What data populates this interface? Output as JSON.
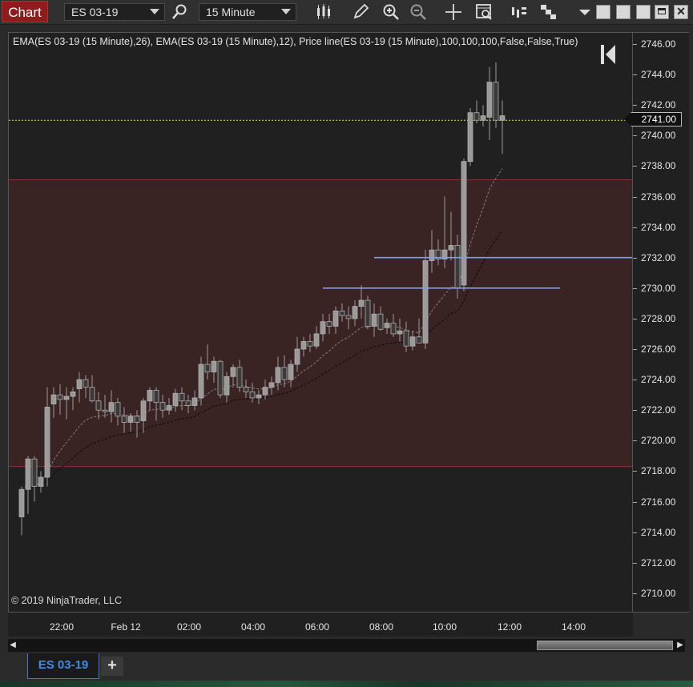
{
  "toolbar": {
    "chart_label": "Chart",
    "instrument": "ES 03-19",
    "interval": "15 Minute",
    "icons": [
      "search-icon",
      "bar-type-icon",
      "draw-pencil-icon",
      "zoom-in-icon",
      "zoom-out-icon",
      "crosshair-icon",
      "data-box-icon",
      "indicators-icon",
      "strategies-icon",
      "menu-dropdown-icon"
    ]
  },
  "chart": {
    "indicator_label": "EMA(ES 03-19 (15 Minute),26), EMA(ES 03-19 (15 Minute),12), Price line(ES 03-19 (15 Minute),100,100,100,False,False,True)",
    "copyright": "© 2019 NinjaTrader, LLC",
    "current_price": "2741.00",
    "y_ticks": [
      "2746.00",
      "2744.00",
      "2742.00",
      "2740.00",
      "2738.00",
      "2736.00",
      "2734.00",
      "2732.00",
      "2730.00",
      "2728.00",
      "2726.00",
      "2724.00",
      "2722.00",
      "2720.00",
      "2718.00",
      "2716.00",
      "2714.00",
      "2712.00",
      "2710.00"
    ],
    "x_ticks": [
      "22:00",
      "Feb 12",
      "02:00",
      "04:00",
      "06:00",
      "08:00",
      "10:00",
      "12:00",
      "14:00"
    ],
    "colors": {
      "background": "#202020",
      "zone": "#3a2323",
      "zone_border": "#8a2f3a",
      "hline": "#7aa0ff",
      "price_line": "#e8e84a",
      "up": "#9a9a9a",
      "down": "#3a3a3a"
    }
  },
  "chart_data": {
    "type": "candlestick",
    "ylim": [
      2709,
      2747
    ],
    "candles": [
      [
        2715.0,
        2717.0,
        2713.8,
        2716.8
      ],
      [
        2716.8,
        2719.0,
        2715.2,
        2718.8
      ],
      [
        2718.8,
        2719.0,
        2716.0,
        2717.0
      ],
      [
        2717.0,
        2718.0,
        2716.6,
        2717.6
      ],
      [
        2717.6,
        2723.5,
        2717.0,
        2722.2
      ],
      [
        2722.4,
        2723.5,
        2721.5,
        2723.0
      ],
      [
        2723.0,
        2723.7,
        2721.7,
        2722.7
      ],
      [
        2722.7,
        2723.5,
        2721.4,
        2722.9
      ],
      [
        2722.9,
        2723.5,
        2722.0,
        2723.2
      ],
      [
        2723.4,
        2724.5,
        2722.5,
        2724.0
      ],
      [
        2724.0,
        2724.3,
        2722.8,
        2723.5
      ],
      [
        2723.5,
        2724.3,
        2722.5,
        2722.6
      ],
      [
        2722.6,
        2723.2,
        2721.4,
        2722.0
      ],
      [
        2722.0,
        2723.0,
        2721.5,
        2721.9
      ],
      [
        2721.9,
        2723.3,
        2721.2,
        2722.5
      ],
      [
        2722.5,
        2722.8,
        2721.0,
        2721.6
      ],
      [
        2721.6,
        2722.2,
        2720.5,
        2721.2
      ],
      [
        2721.2,
        2721.8,
        2720.6,
        2721.6
      ],
      [
        2721.6,
        2722.0,
        2720.2,
        2721.2
      ],
      [
        2721.3,
        2722.8,
        2720.5,
        2722.6
      ],
      [
        2722.6,
        2723.5,
        2722.0,
        2723.3
      ],
      [
        2723.3,
        2723.5,
        2721.3,
        2722.5
      ],
      [
        2722.5,
        2723.0,
        2721.5,
        2722.0
      ],
      [
        2722.0,
        2722.8,
        2721.7,
        2722.3
      ],
      [
        2722.3,
        2723.4,
        2721.9,
        2723.1
      ],
      [
        2723.1,
        2723.5,
        2722.0,
        2722.6
      ],
      [
        2722.6,
        2723.0,
        2721.8,
        2722.3
      ],
      [
        2722.3,
        2723.3,
        2722.0,
        2722.8
      ],
      [
        2722.8,
        2725.5,
        2722.3,
        2725.0
      ],
      [
        2725.0,
        2726.3,
        2724.0,
        2724.5
      ],
      [
        2724.5,
        2725.5,
        2723.8,
        2725.2
      ],
      [
        2725.2,
        2725.3,
        2722.8,
        2723.0
      ],
      [
        2723.0,
        2724.5,
        2722.5,
        2724.2
      ],
      [
        2724.2,
        2725.0,
        2723.5,
        2724.8
      ],
      [
        2724.8,
        2725.3,
        2723.2,
        2723.5
      ],
      [
        2723.5,
        2724.0,
        2722.8,
        2723.2
      ],
      [
        2723.2,
        2723.8,
        2722.5,
        2722.8
      ],
      [
        2722.8,
        2723.3,
        2722.4,
        2723.0
      ],
      [
        2723.0,
        2724.0,
        2722.7,
        2723.5
      ],
      [
        2723.5,
        2724.2,
        2723.0,
        2723.8
      ],
      [
        2723.8,
        2725.5,
        2723.3,
        2724.8
      ],
      [
        2724.8,
        2725.6,
        2723.5,
        2724.0
      ],
      [
        2724.0,
        2725.3,
        2723.5,
        2725.0
      ],
      [
        2725.0,
        2726.8,
        2724.5,
        2726.0
      ],
      [
        2726.0,
        2726.8,
        2725.5,
        2726.5
      ],
      [
        2726.5,
        2727.0,
        2725.8,
        2726.2
      ],
      [
        2726.2,
        2727.5,
        2726.0,
        2727.0
      ],
      [
        2727.0,
        2728.3,
        2726.5,
        2727.8
      ],
      [
        2727.8,
        2728.3,
        2727.0,
        2727.5
      ],
      [
        2727.5,
        2728.8,
        2727.0,
        2728.5
      ],
      [
        2728.5,
        2729.0,
        2727.8,
        2728.2
      ],
      [
        2728.2,
        2728.8,
        2727.3,
        2728.0
      ],
      [
        2728.0,
        2729.2,
        2727.5,
        2728.8
      ],
      [
        2728.8,
        2730.2,
        2728.0,
        2729.2
      ],
      [
        2729.2,
        2729.5,
        2727.3,
        2727.5
      ],
      [
        2727.5,
        2729.0,
        2726.8,
        2728.3
      ],
      [
        2728.3,
        2728.8,
        2727.2,
        2727.3
      ],
      [
        2727.4,
        2728.0,
        2727.0,
        2727.7
      ],
      [
        2727.7,
        2728.3,
        2726.8,
        2727.0
      ],
      [
        2727.0,
        2728.0,
        2726.5,
        2727.2
      ],
      [
        2727.2,
        2727.8,
        2725.8,
        2726.2
      ],
      [
        2726.2,
        2727.2,
        2725.9,
        2726.8
      ],
      [
        2726.8,
        2728.0,
        2726.5,
        2726.4
      ],
      [
        2726.4,
        2732.5,
        2726.0,
        2731.8
      ],
      [
        2731.8,
        2733.8,
        2731.0,
        2732.5
      ],
      [
        2732.5,
        2733.2,
        2731.5,
        2731.9
      ],
      [
        2731.9,
        2736.0,
        2731.3,
        2732.5
      ],
      [
        2732.5,
        2735.0,
        2731.8,
        2732.8
      ],
      [
        2732.8,
        2733.5,
        2729.3,
        2730.0
      ],
      [
        2730.2,
        2738.5,
        2729.8,
        2738.3
      ],
      [
        2738.3,
        2741.8,
        2738.0,
        2741.5
      ],
      [
        2741.5,
        2742.3,
        2740.8,
        2741.0
      ],
      [
        2741.0,
        2742.0,
        2740.6,
        2741.3
      ],
      [
        2741.2,
        2744.5,
        2739.7,
        2743.5
      ],
      [
        2743.5,
        2744.8,
        2740.5,
        2741.0
      ],
      [
        2741.0,
        2742.3,
        2738.8,
        2741.3
      ]
    ],
    "ema_fast_label": "EMA 12",
    "ema_slow_label": "EMA 26",
    "zone": {
      "top": 2737.1,
      "bottom": 2718.3
    },
    "horizontal_lines": [
      {
        "price": 2732.0,
        "from_bar": 55,
        "to_bar": null
      },
      {
        "price": 2730.0,
        "from_bar": 47,
        "to_bar": 84
      }
    ],
    "price_line": 2741.0
  }
}
